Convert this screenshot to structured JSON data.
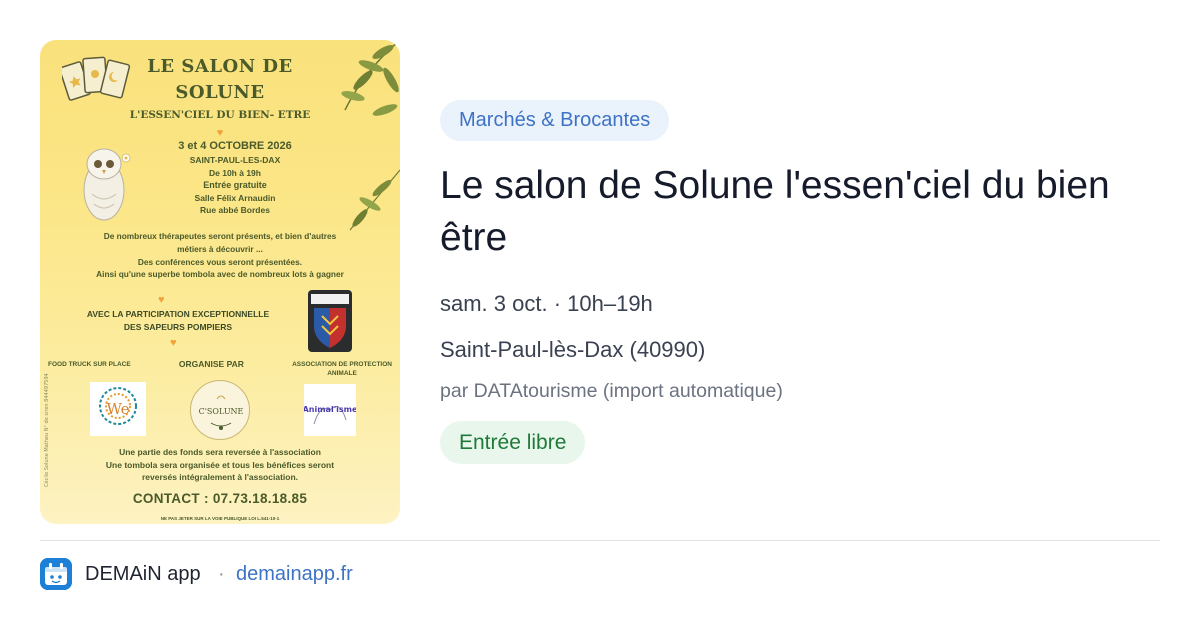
{
  "poster": {
    "title_line1": "LE SALON DE",
    "title_line2": "SOLUNE",
    "subtitle": "L'ESSEN'CIEL DU BIEN- ETRE",
    "dates": "3 et 4 OCTOBRE 2026",
    "city": "SAINT-PAUL-LES-DAX",
    "hours": "De 10h à 19h",
    "entry": "Entrée gratuite",
    "venue": "Salle Félix Arnaudin",
    "street": "Rue abbé Bordes",
    "desc1": "De nombreux thérapeutes seront présents, et bien d'autres",
    "desc2": "métiers à découvrir ...",
    "desc3": "Des conférences vous seront présentées.",
    "desc4": "Ainsi qu'une superbe tombola avec de nombreux lots à gagner",
    "avec1": "AVEC  LA PARTICIPATION EXCEPTIONNELLE",
    "avec2": "DES SAPEURS POMPIERS",
    "food_truck": "FOOD TRUCK SUR PLACE",
    "organise": "ORGANISE PAR",
    "asso1": "ASSOCIATION DE PROTECTION",
    "asso2": "ANIMALE",
    "logo_center": "C'SOLUNE",
    "logo_left": "We",
    "logo_right": "Animal'isme",
    "foot1": "Une partie des fonds sera reversée à l'association",
    "foot2": "Une tombola sera organisée et tous les bénéfices seront",
    "foot3": "reversés intégralement à l'association.",
    "contact": "CONTACT : 07.73.18.18.85",
    "legal": "NE PAS JETER SUR LA VOIE PUBLIQUE LOI L.541-10-1",
    "side_text": "Cécile Solune Matheu N° de siren 844497594"
  },
  "event": {
    "category": "Marchés & Brocantes",
    "title": "Le salon de Solune l'essen'ciel du bien être",
    "when": "sam. 3 oct. · 10h–19h",
    "where": "Saint-Paul-lès-Dax (40990)",
    "source": "par DATAtourisme (import automatique)",
    "price": "Entrée libre"
  },
  "footer": {
    "app_name": "DEMAiN app",
    "separator": "·",
    "domain": "demainapp.fr"
  },
  "colors": {
    "category_bg": "#eaf2fc",
    "category_text": "#3d72c4",
    "price_bg": "#e9f6ec",
    "price_text": "#1f7a3a",
    "link": "#3d72c4",
    "app_icon": "#1d7fd6"
  },
  "icons": {
    "app": "demain-app-icon",
    "poster_decor": [
      "tarot-cards-icon",
      "owl-icon",
      "olive-leaves-icon",
      "heart-icon",
      "firefighter-badge-icon"
    ]
  }
}
